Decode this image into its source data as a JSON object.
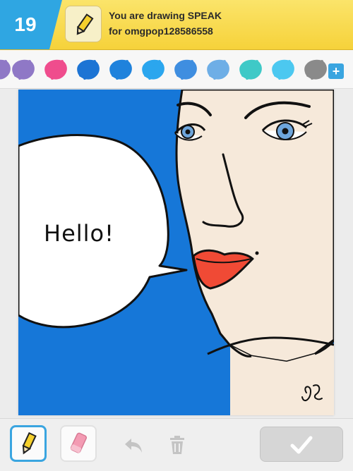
{
  "header": {
    "timer": "19",
    "title_line1": "You are drawing SPEAK",
    "title_line2": "for omgpop128586558",
    "mode_icon": "pencil-icon"
  },
  "palette": {
    "colors": [
      "#8f78c6",
      "#ef4d8d",
      "#1d74d4",
      "#1f82dc",
      "#2ba6ee",
      "#3f8ee0",
      "#6eaee6",
      "#3fc9c7",
      "#4cc8f0",
      "#8a8a8a"
    ],
    "add_icon": "plus-icon",
    "add_label": "+"
  },
  "canvas": {
    "drawn_text": "Hello!",
    "colors": {
      "background": "#1677d8",
      "skin": "#f6e9da",
      "lips": "#f04a35",
      "iris": "#6ea6dc",
      "bubble": "#ffffff",
      "outline": "#111111"
    }
  },
  "toolbar": {
    "pencil_icon": "pencil-icon",
    "eraser_icon": "eraser-icon",
    "undo_icon": "undo-icon",
    "trash_icon": "trash-icon",
    "confirm_icon": "checkmark-icon"
  }
}
